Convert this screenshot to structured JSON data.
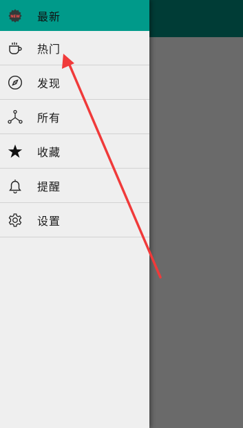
{
  "colors": {
    "accent": "#009a8a",
    "toolbar": "#003c36",
    "scrim": "#6b6b6b",
    "drawer_bg": "#efefef",
    "divider": "#d2d2d2",
    "annotation_arrow": "#f03a3a"
  },
  "drawer": {
    "items": [
      {
        "label": "最新",
        "icon": "new-badge-icon",
        "active": true
      },
      {
        "label": "热门",
        "icon": "cup-icon",
        "active": false
      },
      {
        "label": "发现",
        "icon": "compass-icon",
        "active": false
      },
      {
        "label": "所有",
        "icon": "network-icon",
        "active": false
      },
      {
        "label": "收藏",
        "icon": "star-icon",
        "active": false
      },
      {
        "label": "提醒",
        "icon": "bell-icon",
        "active": false
      },
      {
        "label": "设置",
        "icon": "gear-icon",
        "active": false
      }
    ]
  }
}
